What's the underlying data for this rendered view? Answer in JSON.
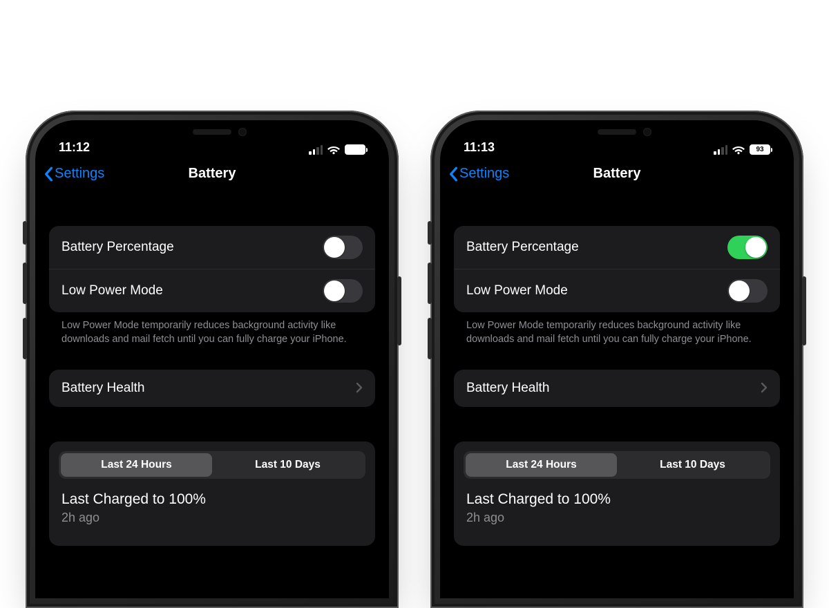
{
  "phones": [
    {
      "time": "11:12",
      "battery_percent_visible": false,
      "battery_percent_text": "",
      "back_label": "Settings",
      "title": "Battery",
      "battery_percentage_label": "Battery Percentage",
      "battery_percentage_on": false,
      "low_power_label": "Low Power Mode",
      "low_power_on": false,
      "note": "Low Power Mode temporarily reduces background activity like downloads and mail fetch until you can fully charge your iPhone.",
      "health_label": "Battery Health",
      "seg_24h": "Last 24 Hours",
      "seg_10d": "Last 10 Days",
      "charged_title": "Last Charged to 100%",
      "charged_sub": "2h ago"
    },
    {
      "time": "11:13",
      "battery_percent_visible": true,
      "battery_percent_text": "93",
      "back_label": "Settings",
      "title": "Battery",
      "battery_percentage_label": "Battery Percentage",
      "battery_percentage_on": true,
      "low_power_label": "Low Power Mode",
      "low_power_on": false,
      "note": "Low Power Mode temporarily reduces background activity like downloads and mail fetch until you can fully charge your iPhone.",
      "health_label": "Battery Health",
      "seg_24h": "Last 24 Hours",
      "seg_10d": "Last 10 Days",
      "charged_title": "Last Charged to 100%",
      "charged_sub": "2h ago"
    }
  ]
}
